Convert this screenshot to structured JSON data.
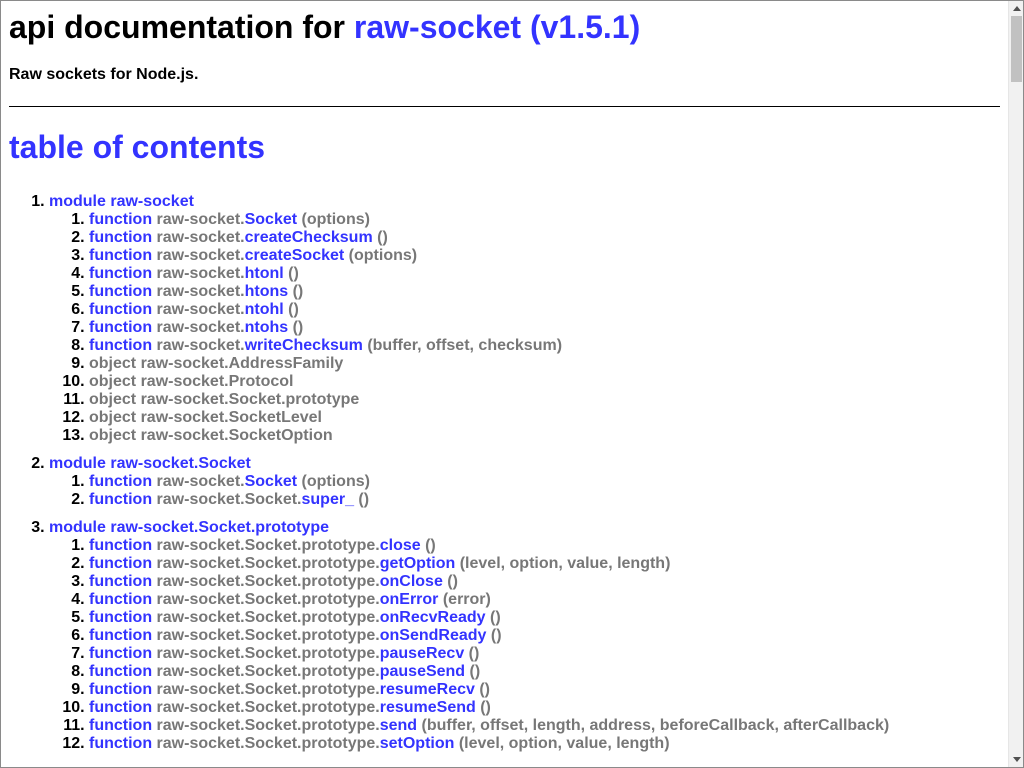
{
  "header": {
    "title_prefix": "api documentation for",
    "title_package": "raw-socket (v1.5.1)",
    "description": "Raw sockets for Node.js."
  },
  "toc": {
    "heading": "table of contents",
    "modules": [
      {
        "label": "module raw-socket",
        "items": [
          {
            "kind": "function",
            "prefix": "raw-socket.",
            "name": "Socket",
            "args": "(options)"
          },
          {
            "kind": "function",
            "prefix": "raw-socket.",
            "name": "createChecksum",
            "args": "()"
          },
          {
            "kind": "function",
            "prefix": "raw-socket.",
            "name": "createSocket",
            "args": "(options)"
          },
          {
            "kind": "function",
            "prefix": "raw-socket.",
            "name": "htonl",
            "args": "()"
          },
          {
            "kind": "function",
            "prefix": "raw-socket.",
            "name": "htons",
            "args": "()"
          },
          {
            "kind": "function",
            "prefix": "raw-socket.",
            "name": "ntohl",
            "args": "()"
          },
          {
            "kind": "function",
            "prefix": "raw-socket.",
            "name": "ntohs",
            "args": "()"
          },
          {
            "kind": "function",
            "prefix": "raw-socket.",
            "name": "writeChecksum",
            "args": "(buffer, offset, checksum)"
          },
          {
            "kind": "object",
            "text": "object raw-socket.AddressFamily"
          },
          {
            "kind": "object",
            "text": "object raw-socket.Protocol"
          },
          {
            "kind": "object",
            "text": "object raw-socket.Socket.prototype"
          },
          {
            "kind": "object",
            "text": "object raw-socket.SocketLevel"
          },
          {
            "kind": "object",
            "text": "object raw-socket.SocketOption"
          }
        ]
      },
      {
        "label": "module raw-socket.Socket",
        "items": [
          {
            "kind": "function",
            "prefix": "raw-socket.",
            "name": "Socket",
            "args": "(options)"
          },
          {
            "kind": "function",
            "prefix": "raw-socket.Socket.",
            "name": "super_",
            "args": "()"
          }
        ]
      },
      {
        "label": "module raw-socket.Socket.prototype",
        "items": [
          {
            "kind": "function",
            "prefix": "raw-socket.Socket.prototype.",
            "name": "close",
            "args": "()"
          },
          {
            "kind": "function",
            "prefix": "raw-socket.Socket.prototype.",
            "name": "getOption",
            "args": "(level, option, value, length)"
          },
          {
            "kind": "function",
            "prefix": "raw-socket.Socket.prototype.",
            "name": "onClose",
            "args": "()"
          },
          {
            "kind": "function",
            "prefix": "raw-socket.Socket.prototype.",
            "name": "onError",
            "args": "(error)"
          },
          {
            "kind": "function",
            "prefix": "raw-socket.Socket.prototype.",
            "name": "onRecvReady",
            "args": "()"
          },
          {
            "kind": "function",
            "prefix": "raw-socket.Socket.prototype.",
            "name": "onSendReady",
            "args": "()"
          },
          {
            "kind": "function",
            "prefix": "raw-socket.Socket.prototype.",
            "name": "pauseRecv",
            "args": "()"
          },
          {
            "kind": "function",
            "prefix": "raw-socket.Socket.prototype.",
            "name": "pauseSend",
            "args": "()"
          },
          {
            "kind": "function",
            "prefix": "raw-socket.Socket.prototype.",
            "name": "resumeRecv",
            "args": "()"
          },
          {
            "kind": "function",
            "prefix": "raw-socket.Socket.prototype.",
            "name": "resumeSend",
            "args": "()"
          },
          {
            "kind": "function",
            "prefix": "raw-socket.Socket.prototype.",
            "name": "send",
            "args": "(buffer, offset, length, address, beforeCallback, afterCallback)"
          },
          {
            "kind": "function",
            "prefix": "raw-socket.Socket.prototype.",
            "name": "setOption",
            "args": "(level, option, value, length)"
          }
        ]
      }
    ]
  },
  "function_keyword": "function",
  "colors": {
    "link": "#3333ff",
    "muted": "#777777",
    "text": "#000000"
  }
}
